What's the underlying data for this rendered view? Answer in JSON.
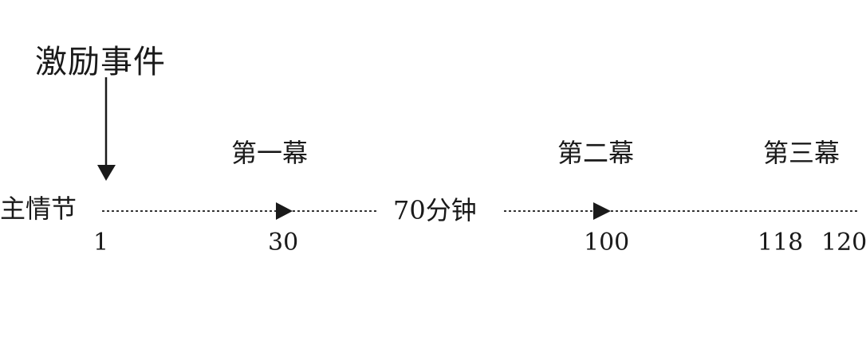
{
  "incident": {
    "label": "激励事件"
  },
  "acts": [
    {
      "label": "第一幕"
    },
    {
      "label": "第二幕"
    },
    {
      "label": "第三幕"
    }
  ],
  "timeline": {
    "label": "主情节",
    "duration_label": "70分钟",
    "ticks": [
      "1",
      "30",
      "100",
      "118",
      "120"
    ]
  }
}
